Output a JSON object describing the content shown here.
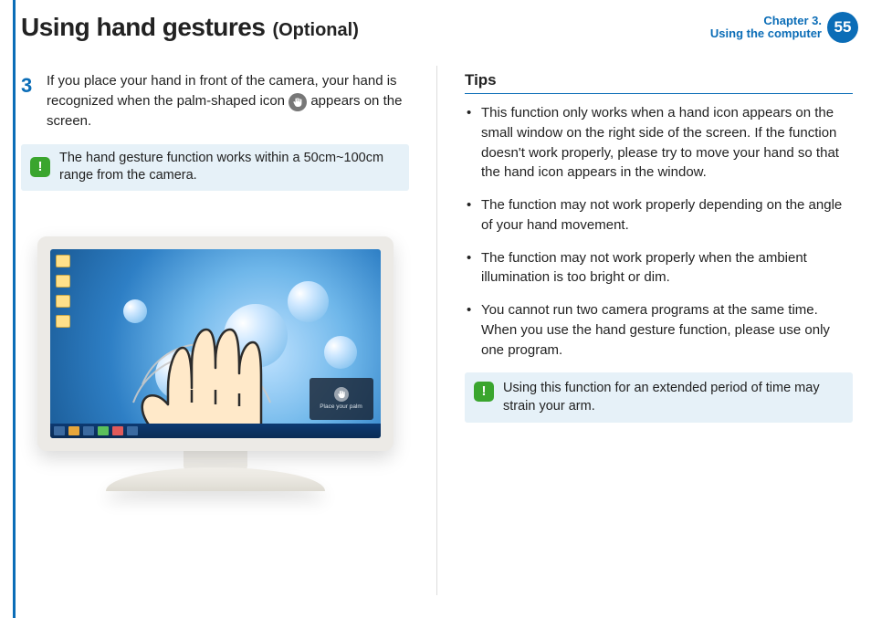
{
  "header": {
    "title": "Using hand gestures",
    "subtitle": "(Optional)",
    "chapter_num": "Chapter 3.",
    "chapter_name": "Using the computer",
    "page": "55"
  },
  "left": {
    "step_number": "3",
    "step_text_a": "If you place your hand in front of the camera, your hand is recognized when the palm-shaped icon ",
    "step_text_b": " appears on the screen.",
    "note": "The hand gesture function works within a 50cm~100cm range from the camera.",
    "popup_caption": "Place your palm"
  },
  "right": {
    "tips_heading": "Tips",
    "tips": [
      "This function only works when a hand icon appears on the small window on the right side of the screen. If the function doesn't work properly, please try to move your hand so that the hand icon appears in the window.",
      "The function may not work properly depending on the angle of your hand movement.",
      "The function may not work properly when the ambient illumination is too bright or dim.",
      "You cannot run two camera programs at the same time. When you use the hand gesture function, please use only one program."
    ],
    "note": "Using this function for an extended period of time may strain your arm."
  }
}
